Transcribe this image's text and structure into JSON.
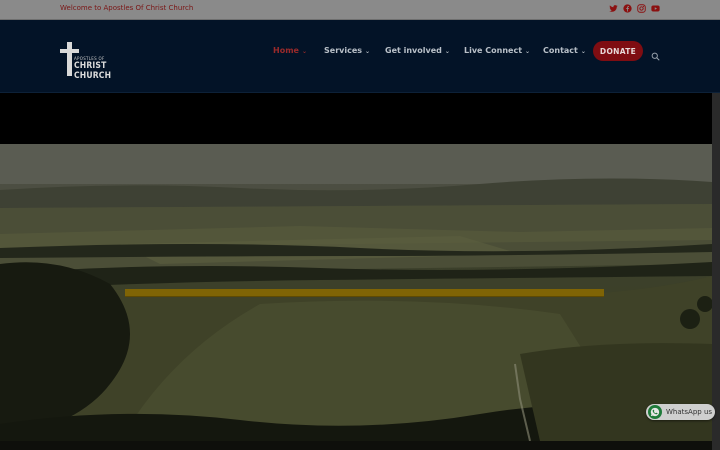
{
  "topbar": {
    "welcome_text": "Welcome to Apostles Of Christ Church",
    "socials": [
      "twitter-icon",
      "facebook-icon",
      "instagram-icon",
      "youtube-icon"
    ]
  },
  "header": {
    "logo": {
      "small_text": "APOSTLES OF",
      "main_text": "CHRIST CHURCH"
    },
    "nav": [
      {
        "label": "Home",
        "active": true
      },
      {
        "label": "Services",
        "active": false
      },
      {
        "label": "Get involved",
        "active": false
      },
      {
        "label": "Live Connect",
        "active": false
      },
      {
        "label": "Contact",
        "active": false
      }
    ],
    "donate_label": "DONATE"
  },
  "whatsapp": {
    "label": "WhatsApp us"
  },
  "colors": {
    "accent": "#7f0d12",
    "header_bg": "#031327",
    "gold_bar": "#7f6405"
  }
}
